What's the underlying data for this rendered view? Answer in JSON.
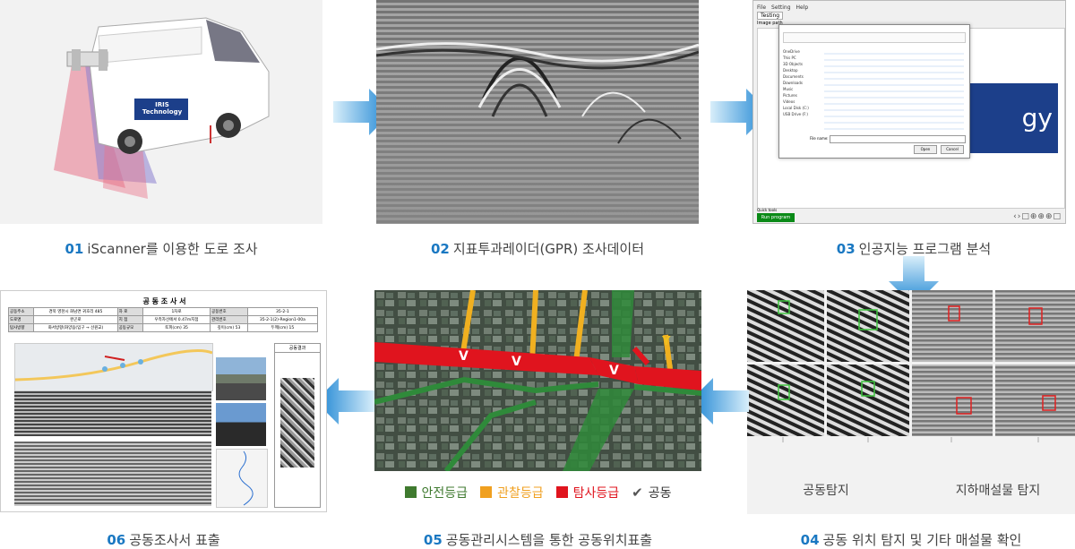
{
  "steps": [
    {
      "num": "01",
      "label": "iScanner를 이용한 도로 조사"
    },
    {
      "num": "02",
      "label": "지표투과레이더(GPR) 조사데이터"
    },
    {
      "num": "03",
      "label": "인공지능 프로그램 분석"
    },
    {
      "num": "04",
      "label": "공동 위치 탐지 및 기타 매설물 확인"
    },
    {
      "num": "05",
      "label": "공동관리시스템을 통한 공동위치표출"
    },
    {
      "num": "06",
      "label": "공동조사서 표출"
    }
  ],
  "van": {
    "brand": "IRIS Technology"
  },
  "program": {
    "menu": [
      "File",
      "Setting",
      "Help"
    ],
    "tab": "Testing",
    "image_path_label": "Image path",
    "file_name_label": "File name:",
    "open_label": "Open",
    "cancel_label": "Cancel",
    "quick_tools_label": "Quick tools",
    "run_label": "Run program",
    "sidebar": [
      "OneDrive",
      "This PC",
      "3D Objects",
      "Desktop",
      "Documents",
      "Downloads",
      "Music",
      "Pictures",
      "Videos",
      "Local Disk (C:)",
      "USB Drive (F:)"
    ],
    "brand_fragment": "gy"
  },
  "detect": {
    "cavity_label": "공동탐지",
    "utility_label": "지하매설물 탐지"
  },
  "map": {
    "legend": [
      {
        "label": "안전등급",
        "color": "#3f7a2f"
      },
      {
        "label": "관찰등급",
        "color": "#f0a020"
      },
      {
        "label": "탐사등급",
        "color": "#e0141e"
      },
      {
        "label": "공동",
        "color": "#555555"
      }
    ],
    "marker": "V",
    "marker_yellow": "Y"
  },
  "report": {
    "title": "공 동 조 사 서",
    "rows": [
      [
        "공동주소",
        "경북 영천시 화남면 귀호리 485",
        "차 로",
        "1차로",
        "공동번호",
        "35-2-1"
      ],
      [
        "도로명",
        "완곤로",
        "지 점",
        "우측자선에서 0.47m지점",
        "관리번호",
        "35-2-1(2)-Region1-00a"
      ],
      [
        "탐사방향",
        "화서방향(화양읍(입구 → 선원교)",
        "공동규모",
        "토피(cm) 35",
        "깊이(cm) 53",
        "두께(cm) 15"
      ]
    ],
    "result_label": "공동결과"
  }
}
